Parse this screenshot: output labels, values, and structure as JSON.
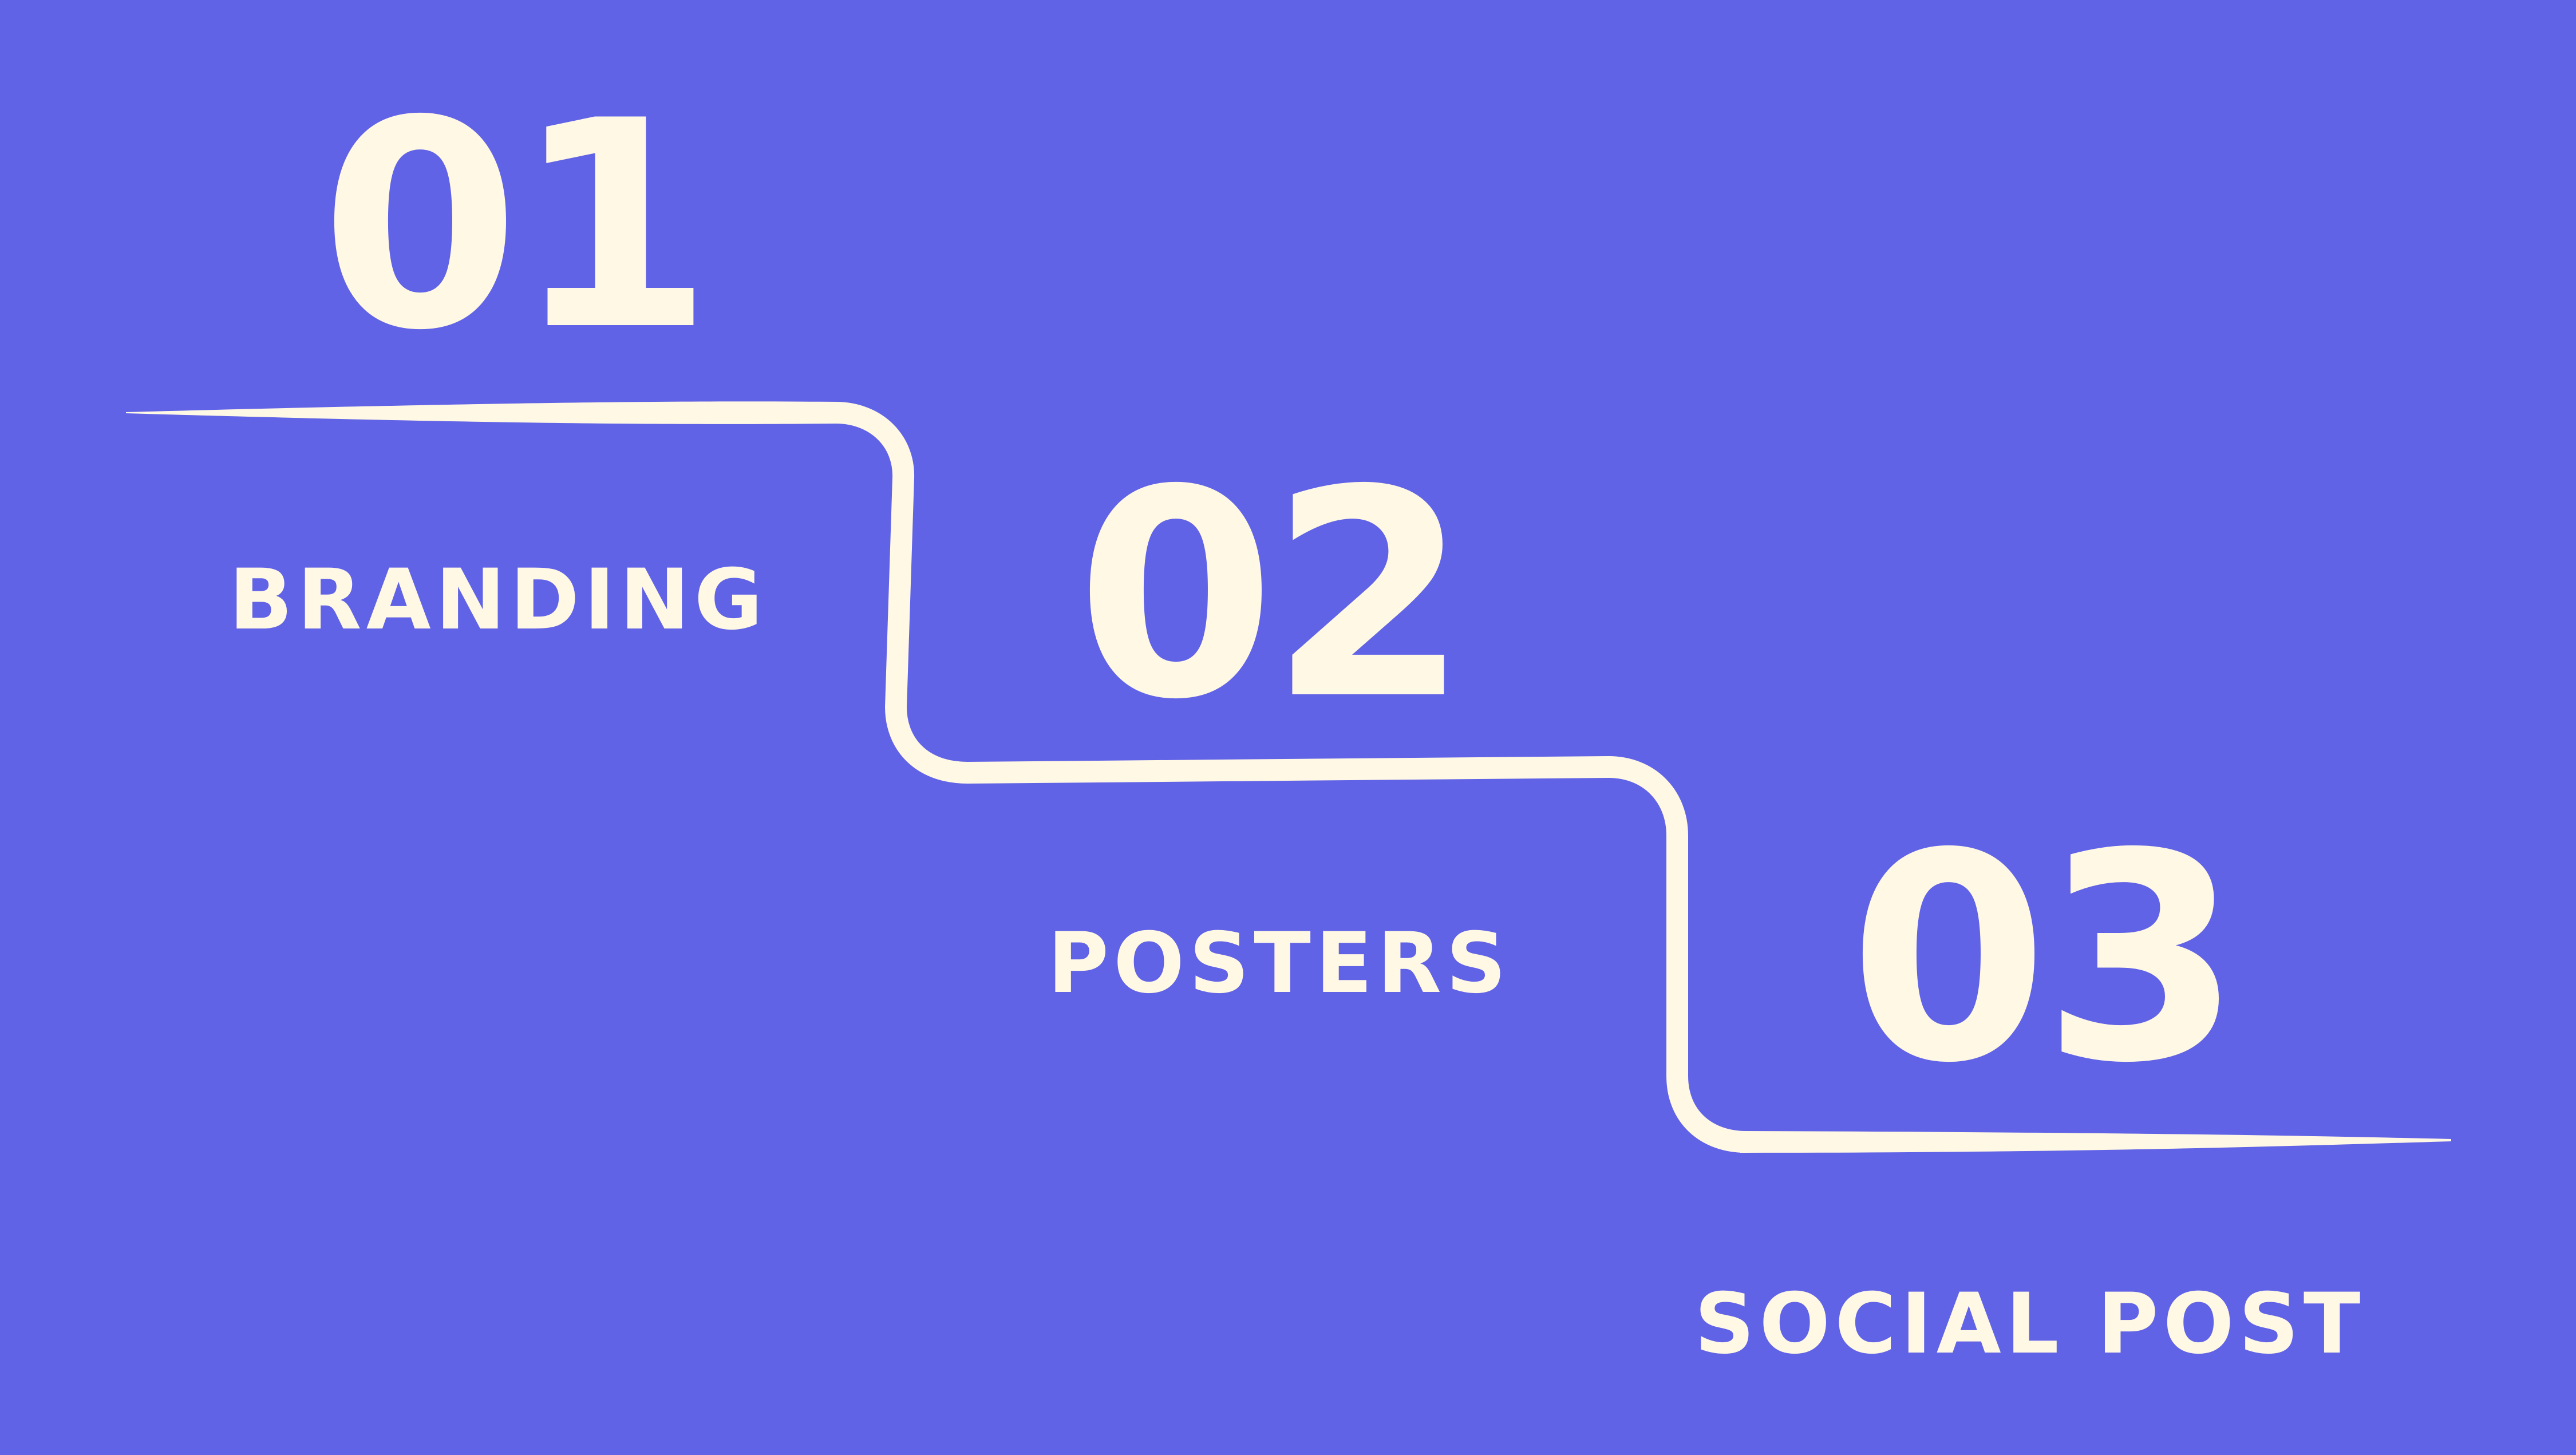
{
  "colors": {
    "background": "#6163E6",
    "foreground": "#FFF8E4"
  },
  "steps": [
    {
      "number": "01",
      "label": "BRANDING"
    },
    {
      "number": "02",
      "label": "POSTERS"
    },
    {
      "number": "03",
      "label": "SOCIAL POST"
    }
  ]
}
